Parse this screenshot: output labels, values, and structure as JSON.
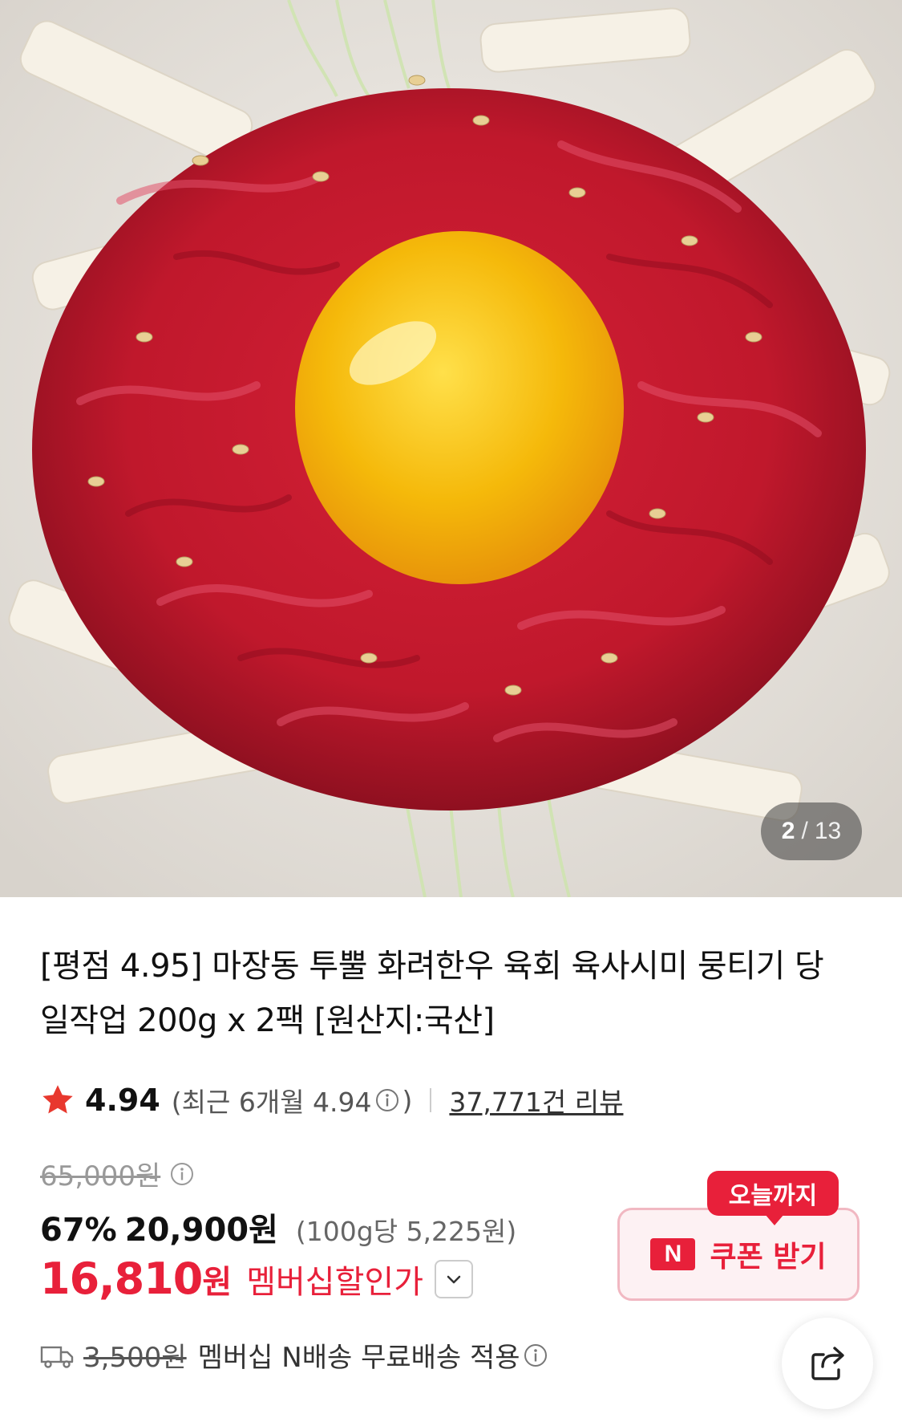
{
  "gallery": {
    "current": "2",
    "separator": "/",
    "total": "13"
  },
  "product": {
    "title": "[평점 4.95] 마장동 투뿔 화려한우 육회 육사시미 뭉티기 당일작업 200g x 2팩 [원산지:국산]"
  },
  "rating": {
    "score": "4.94",
    "recent_prefix": "(최근 6개월 4.94",
    "recent_suffix": ")",
    "reviews": "37,771건 리뷰"
  },
  "price": {
    "original": "65,000원",
    "discount": "67%",
    "sale": "20,900원",
    "unit": "(100g당 5,225원)",
    "member_price": "16,810",
    "member_unit": "원",
    "member_label": "멤버십할인가"
  },
  "shipping": {
    "original_fee": "3,500원",
    "text": "멤버십 N배송 무료배송 적용"
  },
  "coupon": {
    "tag": "오늘까지",
    "badge": "N",
    "label": "쿠폰 받기"
  },
  "icons": {
    "star": "star-icon",
    "info": "info-icon",
    "chevron": "chevron-down-icon",
    "truck": "truck-icon",
    "share": "share-icon"
  },
  "colors": {
    "accent": "#e8203a",
    "star": "#e8382e",
    "coupon_bg": "#fdf1f3"
  }
}
